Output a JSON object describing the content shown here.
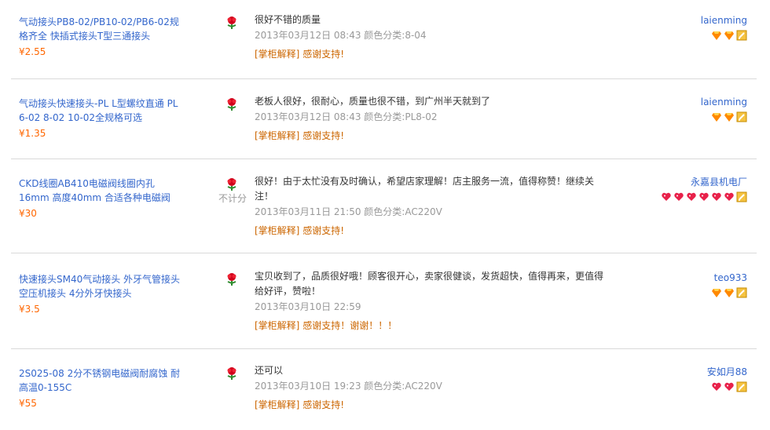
{
  "reviews": [
    {
      "product_title": "气动接头PB8-02/PB10-02/PB6-02规格齐全 快插式接头T型三通接头",
      "price": "¥2.55",
      "score_note": "",
      "comment": "很好不错的质量",
      "meta": "2013年03月12日 08:43 颜色分类:8-04",
      "reply_label": "[掌柜解释]",
      "reply_text": "感谢支持!",
      "username": "laienming",
      "badges": [
        "diamond-icon",
        "diamond-icon"
      ]
    },
    {
      "product_title": "气动接头快速接头-PL L型螺纹直通 PL 6-02 8-02 10-02全规格可选",
      "price": "¥1.35",
      "score_note": "",
      "comment": "老板人很好，很耐心，质量也很不错，到广州半天就到了",
      "meta": "2013年03月12日 08:43 颜色分类:PL8-02",
      "reply_label": "[掌柜解释]",
      "reply_text": "感谢支持!",
      "username": "laienming",
      "badges": [
        "diamond-icon",
        "diamond-icon"
      ]
    },
    {
      "product_title": "CKD线圈AB410电磁阀线圈内孔16mm 高度40mm 合适各种电磁阀",
      "price": "¥30",
      "score_note": "不计分",
      "comment": "很好！由于太忙没有及时确认，希望店家理解！店主服务一流，值得称赞！继续关注！",
      "meta": "2013年03月11日 21:50 颜色分类:AC220V",
      "reply_label": "[掌柜解释]",
      "reply_text": "感谢支持!",
      "username": "永嘉县机电厂",
      "badges": [
        "heart-icon",
        "heart-icon",
        "heart-icon",
        "heart-icon",
        "heart-icon",
        "heart-icon"
      ]
    },
    {
      "product_title": "快速接头SM40气动接头 外牙气管接头 空压机接头 4分外牙快接头",
      "price": "¥3.5",
      "score_note": "",
      "comment": "宝贝收到了，品质很好哦！顾客很开心，卖家很健谈，发货超快，值得再来，更值得给好评，赞啦！",
      "meta": "2013年03月10日 22:59",
      "reply_label": "[掌柜解释]",
      "reply_text": "感谢支持！谢谢！！！",
      "username": "teo933",
      "badges": [
        "diamond-icon",
        "diamond-icon"
      ]
    },
    {
      "product_title": "2S025-08 2分不锈钢电磁阀耐腐蚀 耐高温0-155C",
      "price": "¥55",
      "score_note": "",
      "comment": "还可以",
      "meta": "2013年03月10日 19:23 颜色分类:AC220V",
      "reply_label": "[掌柜解释]",
      "reply_text": "感谢支持!",
      "username": "安如月88",
      "badges": [
        "heart-icon",
        "heart-icon"
      ]
    }
  ],
  "colors": {
    "link": "#3366cc",
    "price": "#ff6600",
    "muted": "#999999",
    "reply": "#cc6600",
    "divider": "#d9d9d9"
  }
}
